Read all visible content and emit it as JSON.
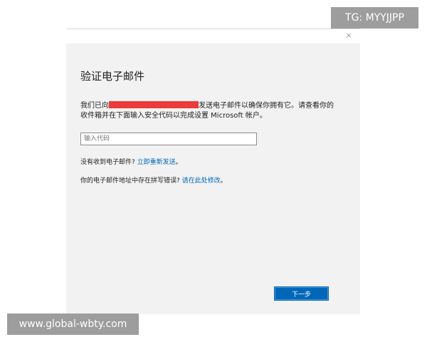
{
  "dialog": {
    "close_glyph": "×",
    "title": "验证电子邮件",
    "desc_before": "我们已向",
    "desc_after": "发送电子邮件以确保你拥有它。请查看你的收件箱并在下面输入安全代码以完成设置 Microsoft 帐户。",
    "redaction_color": "#ec3b3b",
    "code_input": {
      "value": "",
      "placeholder": "输入代码"
    },
    "resend": {
      "prompt": "没有收到电子邮件?",
      "link": "立即重新发送",
      "suffix": "。"
    },
    "fix": {
      "prompt": "你的电子邮件地址中存在拼写错误?",
      "link": "请在此处修改",
      "suffix": "。"
    },
    "next_button": "下一步",
    "accent_color": "#0067b8"
  },
  "watermarks": {
    "top_right": "TG: MYYJJPP",
    "bottom_left": "www.global-wbty.com"
  }
}
